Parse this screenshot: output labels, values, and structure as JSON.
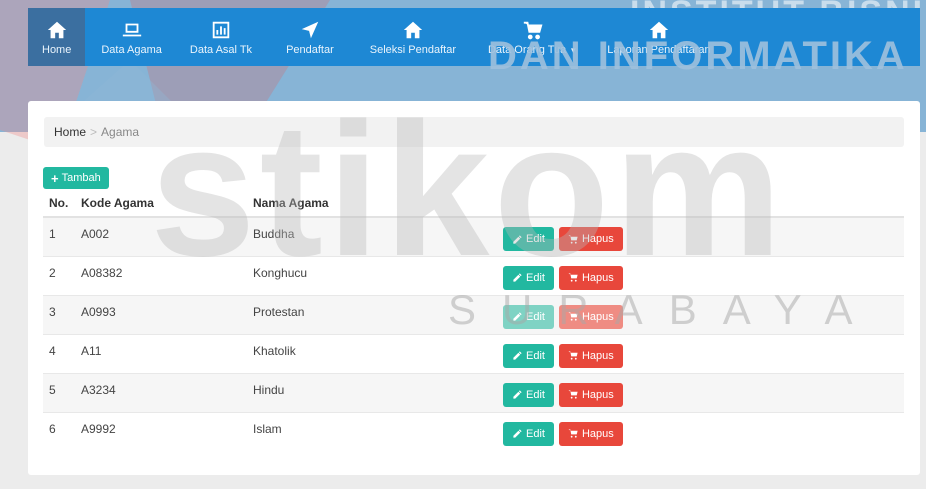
{
  "watermark": {
    "top_text": "INSTITUT BISNIS",
    "mid_text": "DAN INFORMATIKA",
    "big_text": "stikom",
    "sub_text": "SURABAYA"
  },
  "nav": {
    "items": [
      {
        "label": "Home",
        "icon": "home-icon",
        "active": true
      },
      {
        "label": "Data Agama",
        "icon": "laptop-icon",
        "active": false
      },
      {
        "label": "Data Asal Tk",
        "icon": "bar-chart-icon",
        "active": false
      },
      {
        "label": "Pendaftar",
        "icon": "location-arrow-icon",
        "active": false
      },
      {
        "label": "Seleksi Pendaftar",
        "icon": "home-icon",
        "active": false
      },
      {
        "label": "Data Orang Tua",
        "icon": "cart-icon",
        "active": false,
        "dropdown": true
      },
      {
        "label": "Laporan Pendaftaran",
        "icon": "home-icon",
        "active": false
      }
    ]
  },
  "breadcrumb": {
    "home": "Home",
    "current": "Agama"
  },
  "toolbar": {
    "add_label": "Tambah"
  },
  "table": {
    "headers": [
      "No.",
      "Kode Agama",
      "Nama Agama"
    ],
    "edit_label": "Edit",
    "delete_label": "Hapus",
    "rows": [
      {
        "no": "1",
        "kode": "A002",
        "nama": "Buddha"
      },
      {
        "no": "2",
        "kode": "A08382",
        "nama": "Konghucu"
      },
      {
        "no": "3",
        "kode": "A0993",
        "nama": "Protestan"
      },
      {
        "no": "4",
        "kode": "A11",
        "nama": "Khatolik"
      },
      {
        "no": "5",
        "kode": "A3234",
        "nama": "Hindu"
      },
      {
        "no": "6",
        "kode": "A9992",
        "nama": "Islam"
      }
    ]
  },
  "colors": {
    "navbar": "#1e88d4",
    "nav_active": "#3b6fa0",
    "success": "#22b8a0",
    "danger": "#e8473b"
  }
}
